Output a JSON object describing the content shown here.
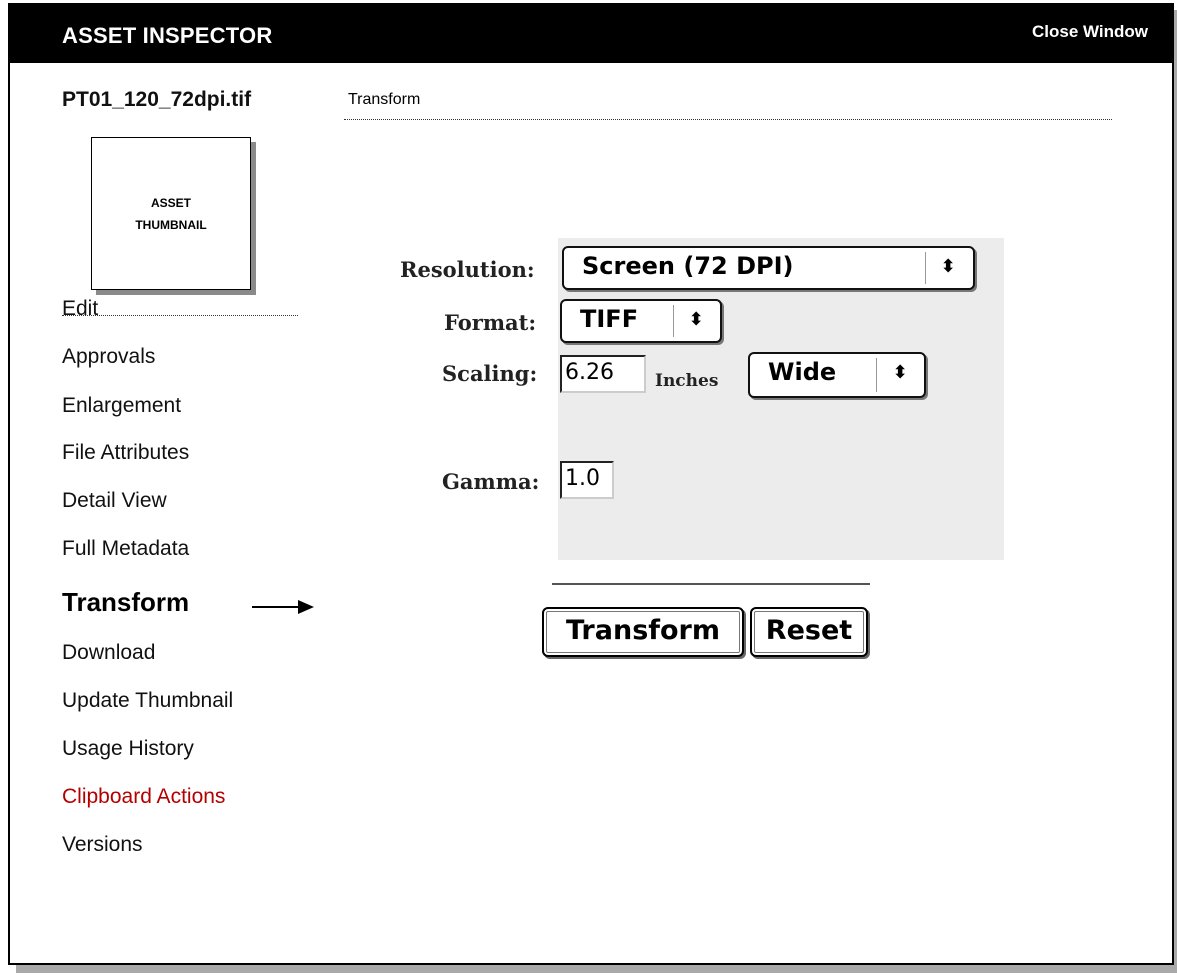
{
  "window": {
    "title": "ASSET INSPECTOR",
    "close_label": "Close Window"
  },
  "asset": {
    "filename": "PT01_120_72dpi.tif",
    "thumbnail_line1": "ASSET",
    "thumbnail_line2": "THUMBNAIL"
  },
  "section": {
    "title": "Transform"
  },
  "nav": {
    "items": [
      {
        "label": "Edit"
      },
      {
        "label": "Approvals"
      },
      {
        "label": "Enlargement"
      },
      {
        "label": "File Attributes"
      },
      {
        "label": "Detail View"
      },
      {
        "label": "Full Metadata"
      },
      {
        "label": "Transform",
        "active": true
      },
      {
        "label": "Download"
      },
      {
        "label": "Update Thumbnail"
      },
      {
        "label": "Usage History"
      },
      {
        "label": "Clipboard Actions",
        "color": "#b40000"
      },
      {
        "label": "Versions"
      }
    ]
  },
  "form": {
    "resolution_label": "Resolution:",
    "resolution_value": "Screen (72 DPI)",
    "format_label": "Format:",
    "format_value": "TIFF",
    "scaling_label": "Scaling:",
    "scaling_value": "6.26",
    "scaling_unit": "Inches",
    "scaling_mode": "Wide",
    "gamma_label": "Gamma:",
    "gamma_value": "1.0",
    "chevron": "⬍"
  },
  "actions": {
    "transform_label": "Transform",
    "reset_label": "Reset"
  }
}
